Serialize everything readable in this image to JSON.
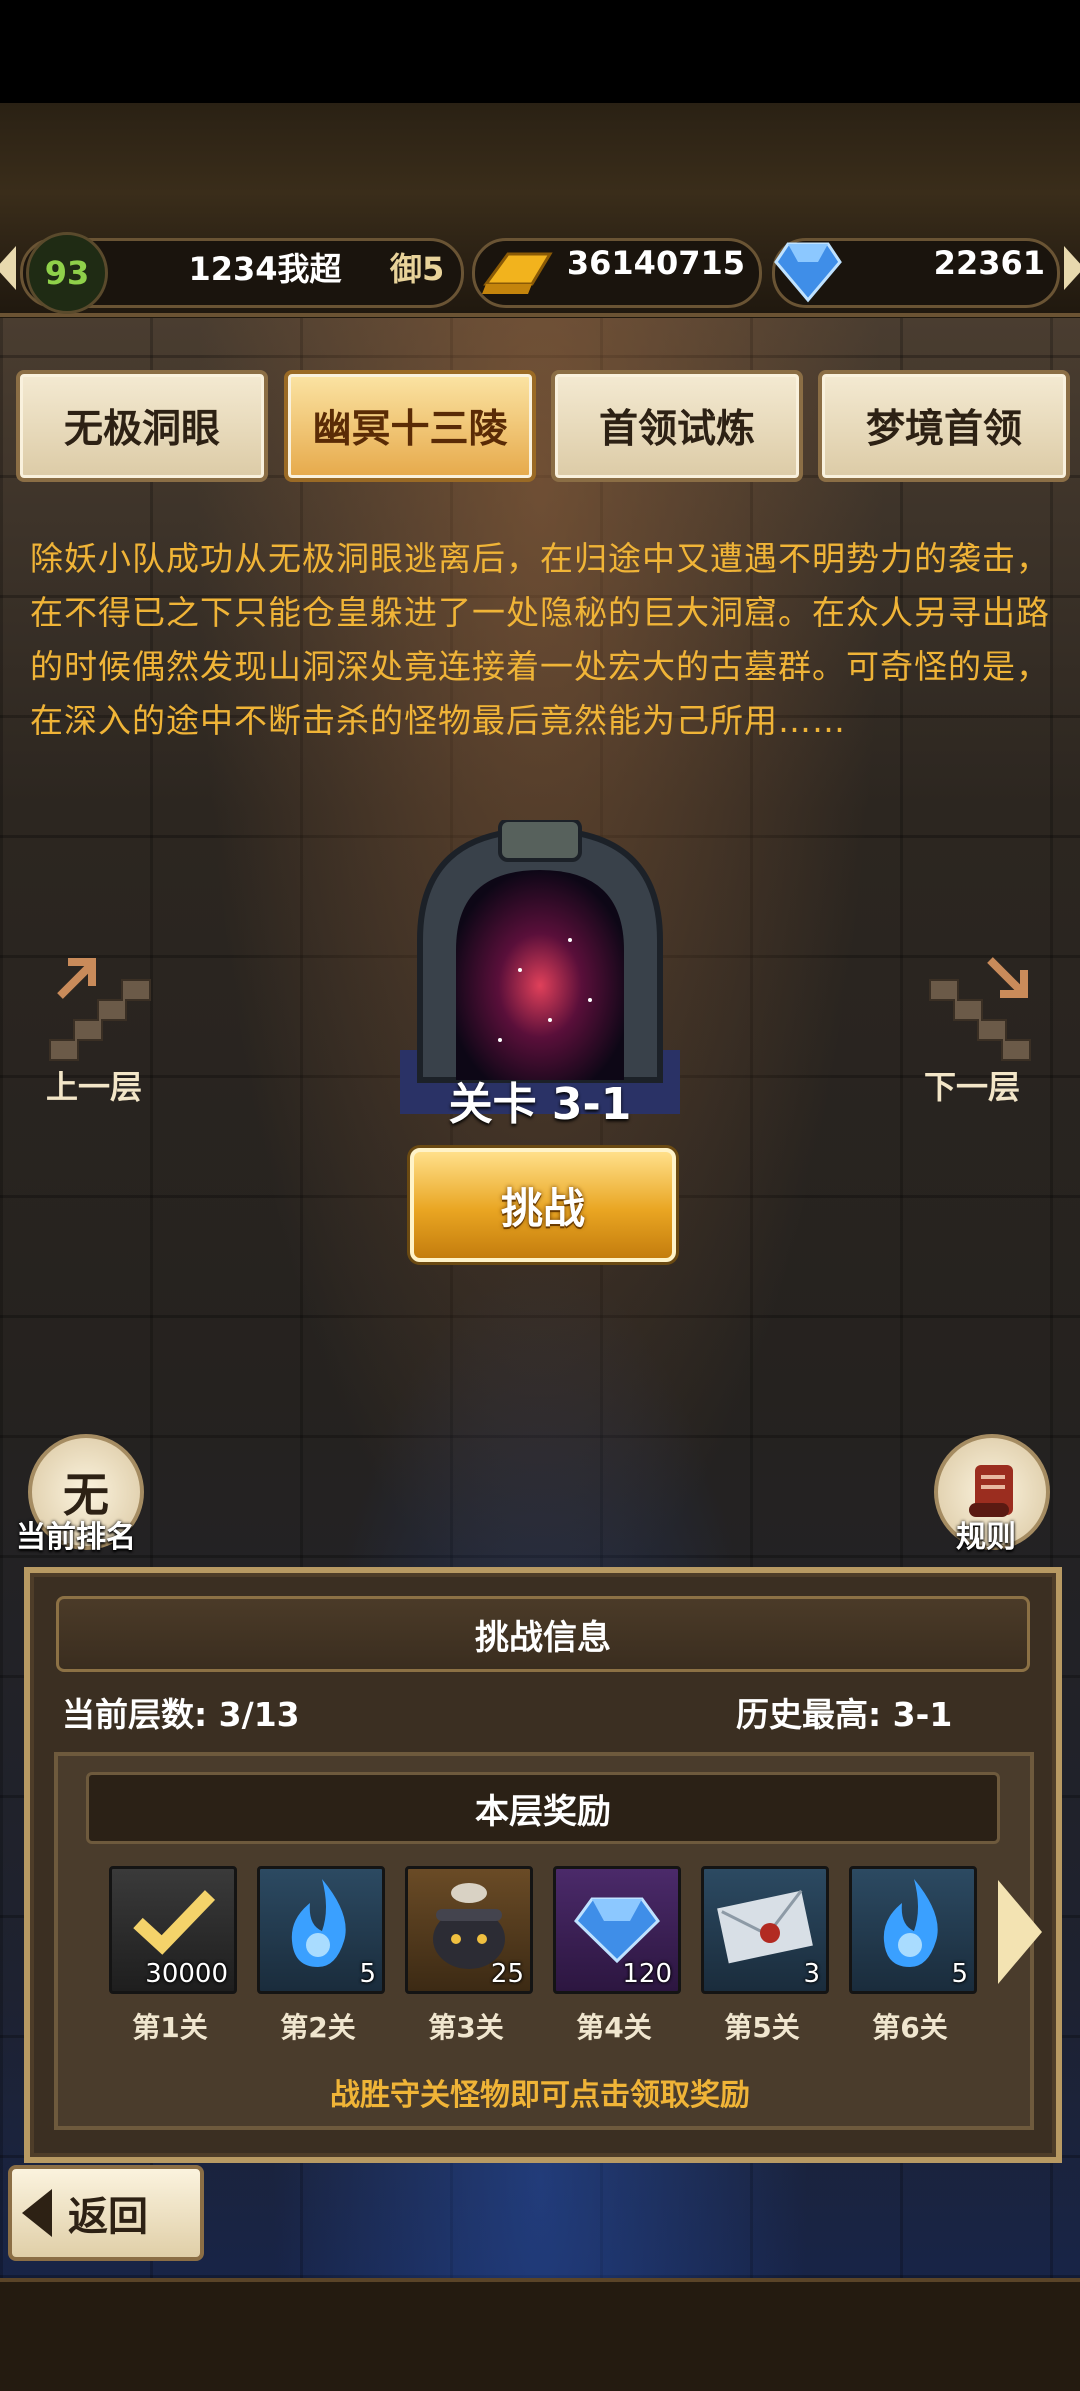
{
  "header": {
    "level": "93",
    "player_name": "1234我超",
    "rank_badge": "御5",
    "gold": "36140715",
    "gems": "22361"
  },
  "tabs": [
    {
      "label": "无极洞眼",
      "active": false
    },
    {
      "label": "幽冥十三陵",
      "active": true
    },
    {
      "label": "首领试炼",
      "active": false
    },
    {
      "label": "梦境首领",
      "active": false
    }
  ],
  "story": "除妖小队成功从无极洞眼逃离后，在归途中又遭遇不明势力的袭击，在不得已之下只能仓皇躲进了一处隐秘的巨大洞窟。在众人另寻出路的时候偶然发现山洞深处竟连接着一处宏大的古墓群。可奇怪的是，在深入的途中不断击杀的怪物最后竟然能为己所用……",
  "stage": {
    "prev_floor": "上一层",
    "next_floor": "下一层",
    "stage_label": "关卡 3-1",
    "challenge": "挑战"
  },
  "rank": {
    "value": "无",
    "label": "当前排名"
  },
  "rules": {
    "label": "规则"
  },
  "info": {
    "title": "挑战信息",
    "current_floor": "当前层数:  3/13",
    "history_best": "历史最高: 3-1",
    "reward_title": "本层奖励",
    "hint": "战胜守关怪物即可点击领取奖励",
    "rewards": [
      {
        "label": "第1关",
        "count": "30000",
        "icon": "claimed-check-icon"
      },
      {
        "label": "第2关",
        "count": "5",
        "icon": "blue-flame-icon"
      },
      {
        "label": "第3关",
        "count": "25",
        "icon": "cauldron-icon"
      },
      {
        "label": "第4关",
        "count": "120",
        "icon": "diamond-icon"
      },
      {
        "label": "第5关",
        "count": "3",
        "icon": "sealed-letter-icon"
      },
      {
        "label": "第6关",
        "count": "5",
        "icon": "blue-flame-icon"
      }
    ]
  },
  "back": {
    "label": "返回"
  },
  "colors": {
    "story_text": "#f0b437",
    "tab_active": "#e6a94a",
    "tab_inactive": "#f4ead2"
  }
}
